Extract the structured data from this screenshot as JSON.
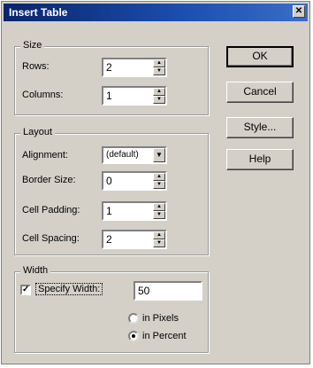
{
  "dialog": {
    "title": "Insert Table",
    "close_symbol": "✕"
  },
  "size": {
    "legend": "Size",
    "rows_label": "Rows:",
    "rows_value": "2",
    "columns_label": "Columns:",
    "columns_value": "1"
  },
  "layout": {
    "legend": "Layout",
    "alignment_label": "Alignment:",
    "alignment_value": "(default)",
    "border_size_label": "Border Size:",
    "border_size_value": "0",
    "cell_padding_label": "Cell Padding:",
    "cell_padding_value": "1",
    "cell_spacing_label": "Cell Spacing:",
    "cell_spacing_value": "2"
  },
  "width": {
    "legend": "Width",
    "specify_label": "Specify Width:",
    "specify_checked": true,
    "value": "50",
    "pixels_label": "in Pixels",
    "percent_label": "in Percent",
    "selected_unit": "percent"
  },
  "buttons": {
    "ok": "OK",
    "cancel": "Cancel",
    "style": "Style...",
    "help": "Help"
  },
  "icons": {
    "check": "✓",
    "up_arrow": "▲",
    "down_arrow": "▼"
  }
}
